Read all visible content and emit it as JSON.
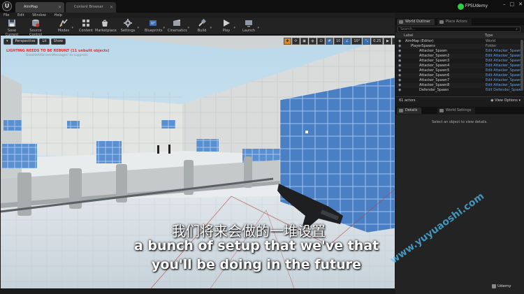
{
  "titlebar": {
    "tabs": [
      {
        "label": "AimMap"
      },
      {
        "label": "Content Browser"
      }
    ],
    "project_name": "FPSUdemy",
    "window_buttons": [
      "–",
      "□",
      "✕"
    ]
  },
  "menubar": {
    "items": [
      "File",
      "Edit",
      "Window",
      "Help"
    ]
  },
  "toolbar": {
    "items": [
      {
        "label": "Save Current",
        "icon": "save-icon"
      },
      {
        "label": "Source Control",
        "icon": "source-control-icon"
      },
      {
        "label": "Modes",
        "icon": "modes-icon"
      },
      {
        "label": "Content",
        "icon": "content-icon"
      },
      {
        "label": "Marketplace",
        "icon": "marketplace-icon"
      },
      {
        "label": "Settings",
        "icon": "gear-icon"
      },
      {
        "label": "Blueprints",
        "icon": "blueprint-icon"
      },
      {
        "label": "Cinematics",
        "icon": "cinematics-icon"
      },
      {
        "label": "Build",
        "icon": "build-icon"
      },
      {
        "label": "Play",
        "icon": "play-icon"
      },
      {
        "label": "Launch",
        "icon": "launch-icon"
      }
    ]
  },
  "viewport": {
    "perspective_label": "Perspective",
    "lit_label": "Lit",
    "show_label": "Show",
    "lighting_warning": "LIGHTING NEEDS TO BE REBUILT (11 unbuilt objects)",
    "disable_message": "DisableAllScreenMessages' to suppress",
    "grid_snap": "10",
    "rotation_snap": "10°",
    "scale_snap": "0.25",
    "camera_speed": "4"
  },
  "subtitles": {
    "chinese": "我们将来会做的一堆设置",
    "english_line1": "a bunch of setup that we've that",
    "english_line2": "you'll be doing in the future"
  },
  "watermark": "www.yuyuaoshi.com",
  "world_outliner": {
    "tab_label": "World Outliner",
    "tab2_label": "Place Actors",
    "search_placeholder": "Search...",
    "col_label": "Label",
    "col_type": "Type",
    "rows": [
      {
        "label": "AimMap (Editor)",
        "type": "World"
      },
      {
        "label": "PlayerSpawns",
        "type": "Folder"
      },
      {
        "label": "Attacker_Spawn",
        "type": "Edit Attacker_Spawn"
      },
      {
        "label": "Attacker_Spawn2",
        "type": "Edit Attacker_Spawn"
      },
      {
        "label": "Attacker_Spawn3",
        "type": "Edit Attacker_Spawn"
      },
      {
        "label": "Attacker_Spawn4",
        "type": "Edit Attacker_Spawn"
      },
      {
        "label": "Attacker_Spawn5",
        "type": "Edit Attacker_Spawn"
      },
      {
        "label": "Attacker_Spawn6",
        "type": "Edit Attacker_Spawn"
      },
      {
        "label": "Attacker_Spawn7",
        "type": "Edit Attacker_Spawn"
      },
      {
        "label": "Attacker_Spawn8",
        "type": "Edit Attacker_Spawn"
      },
      {
        "label": "Defender_Spawn",
        "type": "Edit Defender_Spawn"
      }
    ],
    "actor_count": "61 actors",
    "view_options": "View Options"
  },
  "details": {
    "tab_label": "Details",
    "tab2_label": "World Settings",
    "empty_message": "Select an object to view details."
  },
  "brand": "Udemy"
}
